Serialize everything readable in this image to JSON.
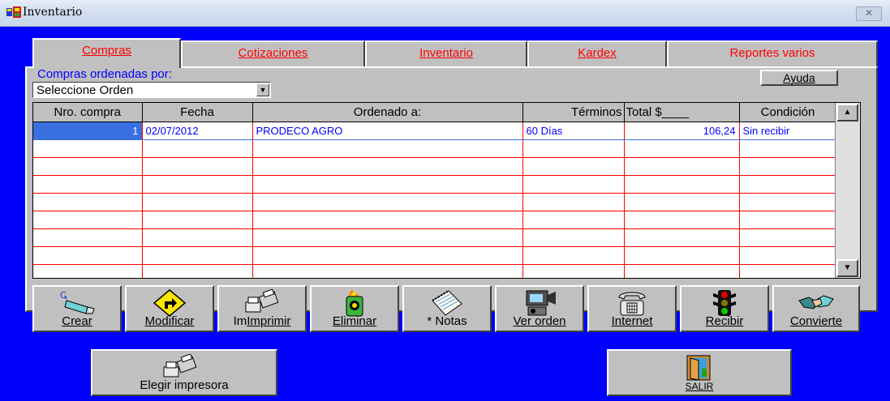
{
  "window": {
    "title": "Inventario",
    "close_label": "⊗"
  },
  "tabs": [
    {
      "label": "Compras",
      "active": true
    },
    {
      "label": "Cotizaciones",
      "active": false
    },
    {
      "label": "Inventario",
      "active": false
    },
    {
      "label": "Kardex",
      "active": false
    },
    {
      "label": "Reportes varios",
      "active": false
    }
  ],
  "order": {
    "label": "Compras ordenadas por:",
    "select_value": "Seleccione Orden"
  },
  "help_label": "Ayuda",
  "grid": {
    "columns": [
      "Nro. compra",
      "Fecha",
      "Ordenado a:",
      "Términos",
      "Total $____",
      "Condición"
    ],
    "rows": [
      [
        "1",
        "02/07/2012",
        "PRODECO AGRO",
        "60 Días",
        "106,24",
        "Sin recibir"
      ]
    ]
  },
  "toolbar": [
    {
      "label": "Crear",
      "icon": "glue-pen-icon"
    },
    {
      "label": "Modificar",
      "icon": "turn-sign-icon"
    },
    {
      "label": "Imprimir",
      "icon": "printer-icon"
    },
    {
      "label": "Eliminar",
      "icon": "trash-fire-icon"
    },
    {
      "label": "* Notas",
      "icon": "notepad-icon"
    },
    {
      "label": "Ver orden",
      "icon": "camera-icon"
    },
    {
      "label": "Internet",
      "icon": "telephone-icon"
    },
    {
      "label": "Recibir",
      "icon": "traffic-light-icon"
    },
    {
      "label": "Convierte",
      "icon": "handshake-icon"
    }
  ],
  "footer": {
    "printer_label": "Elegir impresora",
    "exit_label": "SALIR"
  },
  "colors": {
    "background": "#0000ff",
    "panel": "#c0c0c0",
    "tab_text": "#ff0000",
    "grid_lines": "#ff0000",
    "grid_text": "#0000ff",
    "selection": "#3a6fe0"
  }
}
